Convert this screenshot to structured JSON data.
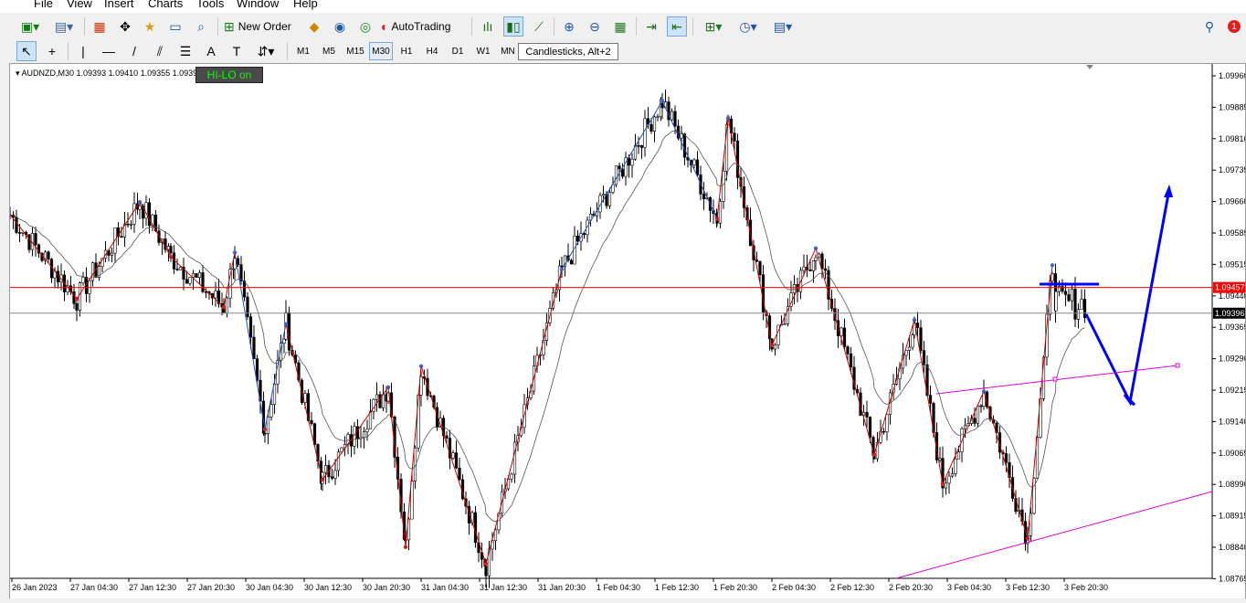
{
  "menu": [
    "File",
    "View",
    "Insert",
    "Charts",
    "Tools",
    "Window",
    "Help"
  ],
  "toolbar": {
    "new_order": "New Order",
    "auto_trading": "AutoTrading"
  },
  "timeframes": [
    "M1",
    "M5",
    "M15",
    "M30",
    "H1",
    "H4",
    "D1",
    "W1",
    "MN"
  ],
  "selected_timeframe": "M30",
  "tooltip": "Candlesticks, Alt+2",
  "notification_count": "1",
  "chart": {
    "symbol_line": "AUDNZD,M30  1.09393 1.09410 1.09355 1.09396",
    "indicator_label": "HI-LO on",
    "price_labels": [
      "1.09960",
      "1.09885",
      "1.09810",
      "1.09735",
      "1.09660",
      "1.09585",
      "1.09515",
      "1.09440",
      "1.09365",
      "1.09290",
      "1.09215",
      "1.09140",
      "1.09065",
      "1.08990",
      "1.08915",
      "1.08840",
      "1.08765"
    ],
    "red_line_label": "1.09457",
    "current_price_label": "1.09396",
    "time_labels": [
      "26 Jan 2023",
      "27 Jan 04:30",
      "27 Jan 12:30",
      "27 Jan 20:30",
      "30 Jan 04:30",
      "30 Jan 12:30",
      "30 Jan 20:30",
      "31 Jan 04:30",
      "31 Jan 12:30",
      "31 Jan 20:30",
      "1 Feb 04:30",
      "1 Feb 12:30",
      "1 Feb 20:30",
      "2 Feb 04:30",
      "2 Feb 12:30",
      "2 Feb 20:30",
      "3 Feb 04:30",
      "3 Feb 12:30",
      "3 Feb 20:30"
    ],
    "colors": {
      "red_line": "#ff0000",
      "zigzag": "#cc0000",
      "ma": "#555555",
      "blue": "#0000ff",
      "magenta": "#dd00dd"
    }
  }
}
